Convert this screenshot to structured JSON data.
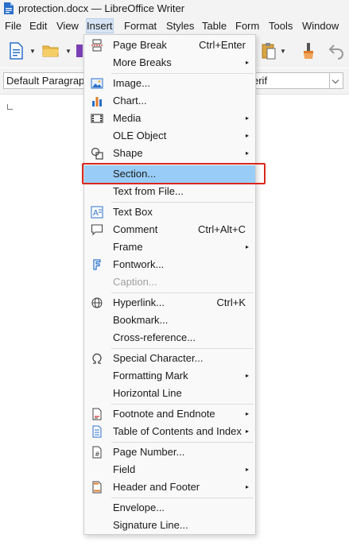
{
  "window": {
    "title": "protection.docx — LibreOffice Writer"
  },
  "menubar": [
    "File",
    "Edit",
    "View",
    "Insert",
    "Format",
    "Styles",
    "Table",
    "Form",
    "Tools",
    "Window"
  ],
  "toolbar": {
    "paragraph_style": "Default Paragrap",
    "font_name_visible": "erif"
  },
  "insert_menu": {
    "items": [
      {
        "label": "Page Break",
        "shortcut": "Ctrl+Enter",
        "icon": "page-break-icon"
      },
      {
        "label": "More Breaks",
        "submenu": true
      },
      {
        "label": "Image...",
        "icon": "image-icon"
      },
      {
        "label": "Chart...",
        "icon": "chart-icon"
      },
      {
        "label": "Media",
        "submenu": true,
        "icon": "media-icon"
      },
      {
        "label": "OLE Object",
        "submenu": true
      },
      {
        "label": "Shape",
        "submenu": true,
        "icon": "shape-icon"
      },
      {
        "label": "Section...",
        "highlighted": true
      },
      {
        "label": "Text from File..."
      },
      {
        "label": "Text Box",
        "icon": "text-box-icon"
      },
      {
        "label": "Comment",
        "shortcut": "Ctrl+Alt+C",
        "icon": "comment-icon"
      },
      {
        "label": "Frame",
        "submenu": true
      },
      {
        "label": "Fontwork...",
        "icon": "fontwork-icon"
      },
      {
        "label": "Caption...",
        "disabled": true
      },
      {
        "label": "Hyperlink...",
        "shortcut": "Ctrl+K",
        "icon": "hyperlink-icon"
      },
      {
        "label": "Bookmark..."
      },
      {
        "label": "Cross-reference..."
      },
      {
        "label": "Special Character...",
        "icon": "special-character-icon"
      },
      {
        "label": "Formatting Mark",
        "submenu": true
      },
      {
        "label": "Horizontal Line"
      },
      {
        "label": "Footnote and Endnote",
        "submenu": true,
        "icon": "footnote-icon"
      },
      {
        "label": "Table of Contents and Index",
        "submenu": true,
        "icon": "table-of-contents-icon"
      },
      {
        "label": "Page Number...",
        "icon": "page-number-icon"
      },
      {
        "label": "Field",
        "submenu": true
      },
      {
        "label": "Header and Footer",
        "submenu": true,
        "icon": "header-footer-icon"
      },
      {
        "label": "Envelope..."
      },
      {
        "label": "Signature Line..."
      }
    ],
    "submenu_glyph": "▸"
  },
  "colors": {
    "highlight": "#99cdf7",
    "focus_outline": "#d9271c",
    "menu_background": "#f9f9f9",
    "chrome_background": "#f3f3f3"
  }
}
